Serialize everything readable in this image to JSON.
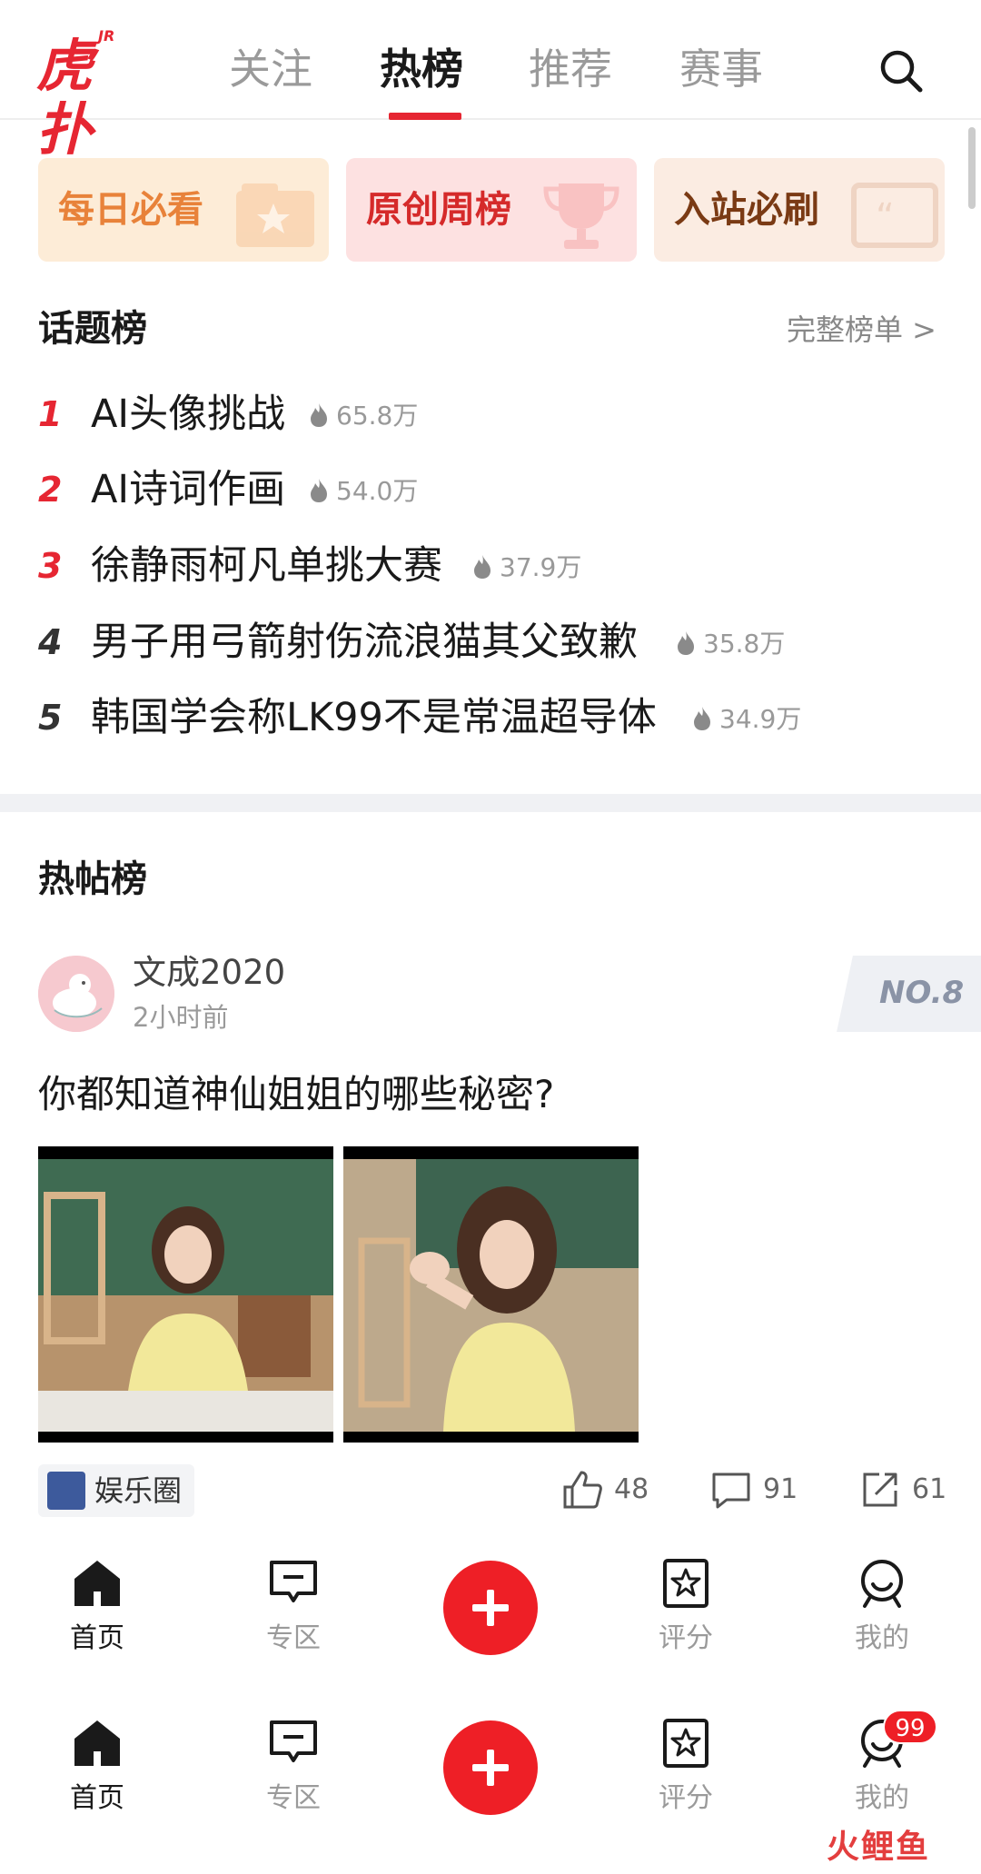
{
  "header": {
    "logo_text": "虎扑",
    "logo_badge": "JR",
    "tabs": [
      {
        "label": "关注"
      },
      {
        "label": "热榜"
      },
      {
        "label": "推荐"
      },
      {
        "label": "赛事"
      }
    ],
    "active_tab": "热榜",
    "search_icon": "search-icon"
  },
  "quick_cards": [
    {
      "label": "每日必看",
      "icon": "star-folder-icon",
      "color": "#e8823a"
    },
    {
      "label": "原创周榜",
      "icon": "trophy-icon",
      "color": "#d52a2a"
    },
    {
      "label": "入站必刷",
      "icon": "quote-icon",
      "color": "#7a3a14"
    }
  ],
  "topics": {
    "title": "话题榜",
    "more": "完整榜单 >",
    "items": [
      {
        "rank": "1",
        "text": "AI头像挑战",
        "heat": "65.8万"
      },
      {
        "rank": "2",
        "text": "AI诗词作画",
        "heat": "54.0万"
      },
      {
        "rank": "3",
        "text": "徐静雨柯凡单挑大赛",
        "heat": "37.9万"
      },
      {
        "rank": "4",
        "text": "男子用弓箭射伤流浪猫其父致歉",
        "heat": "35.8万"
      },
      {
        "rank": "5",
        "text": "韩国学会称LK99不是常温超导体",
        "heat": "34.9万"
      }
    ]
  },
  "hot_posts": {
    "title": "热帖榜",
    "post": {
      "author": "文成2020",
      "time": "2小时前",
      "rank": "NO.8",
      "title": "你都知道神仙姐姐的哪些秘密?",
      "tag": "娱乐圈",
      "likes": "48",
      "comments": "91",
      "shares": "61"
    }
  },
  "bottom_nav": {
    "items": [
      {
        "label": "首页",
        "icon": "home-icon"
      },
      {
        "label": "专区",
        "icon": "zone-icon"
      },
      {
        "label": "评分",
        "icon": "rating-icon"
      },
      {
        "label": "我的",
        "icon": "profile-icon"
      }
    ],
    "badge": "99"
  },
  "watermark": "火鲤鱼",
  "colors": {
    "accent": "#e62632",
    "fab": "#ee1f26"
  }
}
